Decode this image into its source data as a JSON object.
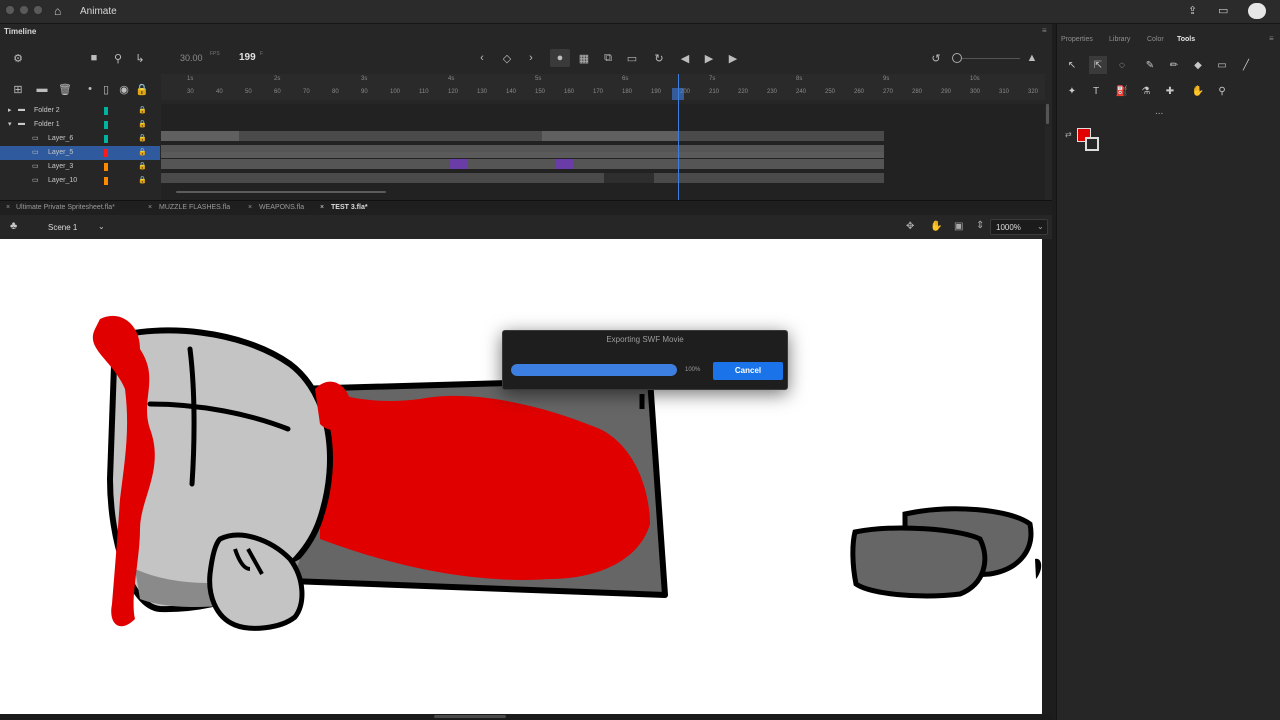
{
  "app": {
    "title": "Animate"
  },
  "timeline": {
    "panel_label": "Timeline",
    "fps": "30.00",
    "fps_unit": "FPS",
    "current_frame": "199",
    "frame_suffix": "F",
    "ruler_seconds": [
      "1s",
      "2s",
      "3s",
      "4s",
      "5s",
      "6s",
      "7s",
      "8s",
      "9s",
      "10s"
    ],
    "ruler_frames": [
      "30",
      "40",
      "50",
      "60",
      "70",
      "80",
      "90",
      "100",
      "110",
      "120",
      "130",
      "140",
      "150",
      "160",
      "170",
      "180",
      "190",
      "200",
      "210",
      "220",
      "230",
      "240",
      "250",
      "260",
      "270",
      "280",
      "290",
      "300",
      "310",
      "320"
    ],
    "playhead_frame": 199,
    "layers": [
      {
        "name": "Folder 2",
        "type": "folder",
        "color": "#00b3a1"
      },
      {
        "name": "Folder 1",
        "type": "folder",
        "color": "#00b3a1"
      },
      {
        "name": "Layer_6",
        "type": "layer",
        "color": "#00b3a1"
      },
      {
        "name": "Layer_5",
        "type": "layer",
        "color": "#ff1a1a",
        "selected": true
      },
      {
        "name": "Layer_3",
        "type": "layer",
        "color": "#ff8a00"
      },
      {
        "name": "Layer_10",
        "type": "layer",
        "color": "#ff8a00"
      }
    ]
  },
  "doc_tabs": [
    "Ultimate Private Spritesheet.fla*",
    "MUZZLE FLASHES.fla",
    "WEAPONS.fla",
    "TEST 3.fla*"
  ],
  "scene": {
    "label": "Scene 1",
    "zoom": "1000%"
  },
  "right_panel": {
    "tabs": [
      "Properties",
      "Library",
      "Color",
      "Tools"
    ],
    "active_tab": "Tools",
    "more": "...",
    "stroke_color": "#e00000"
  },
  "dialog": {
    "title": "Exporting SWF Movie",
    "progress_percent": "100%",
    "progress_value": 1.0,
    "cancel_label": "Cancel"
  },
  "colors": {
    "accent": "#1a73e8",
    "blood": "#e00000",
    "playhead": "#3d7fe0"
  }
}
